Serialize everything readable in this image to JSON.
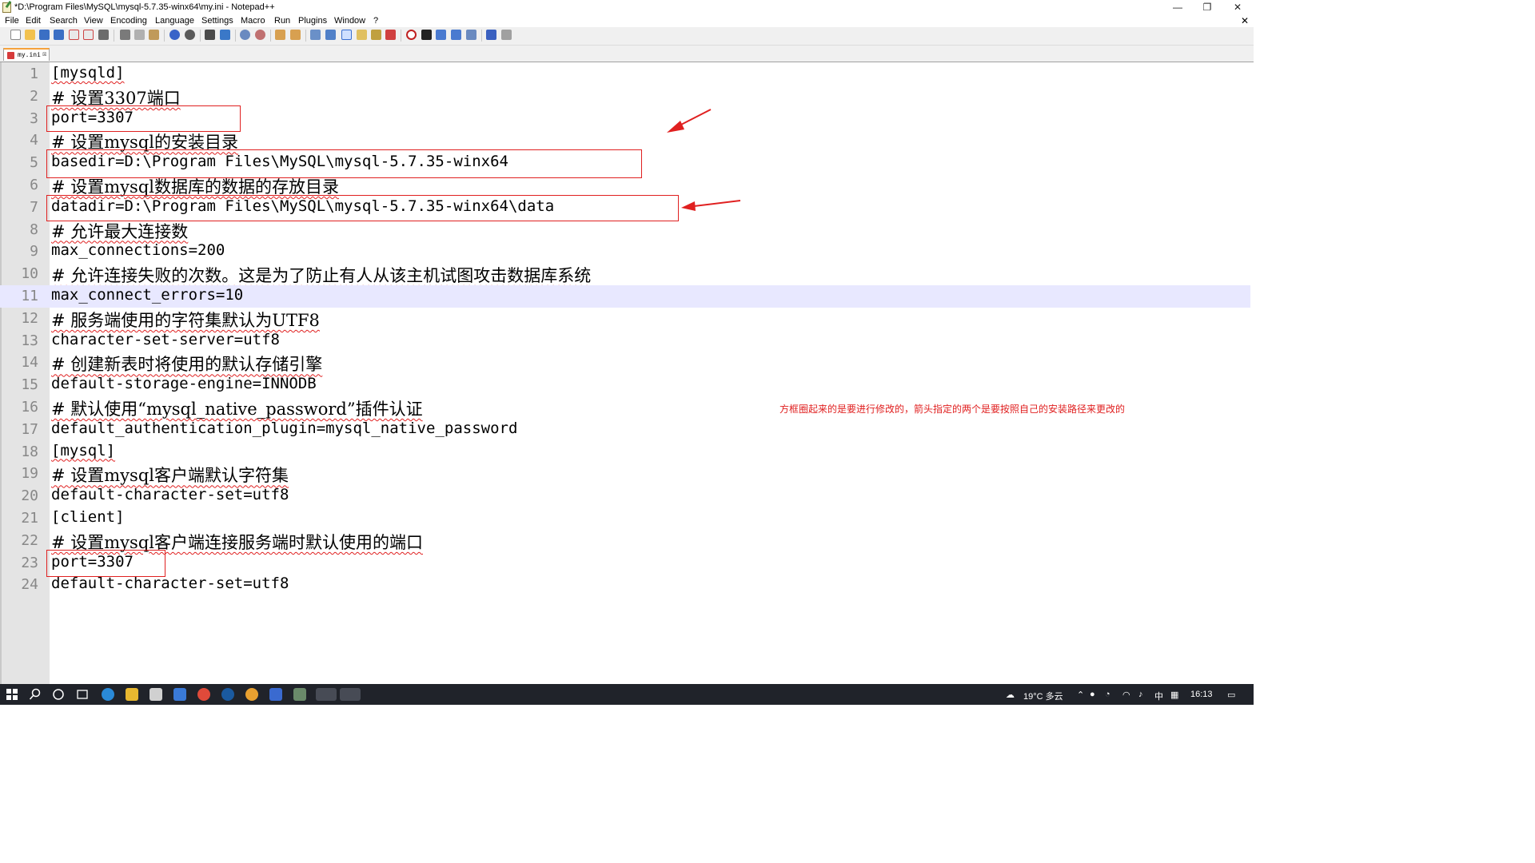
{
  "window": {
    "title": "*D:\\Program Files\\MySQL\\mysql-5.7.35-winx64\\my.ini - Notepad++",
    "minimize": "—",
    "restore": "❐",
    "close": "✕"
  },
  "menu": {
    "items": [
      "File",
      "Edit",
      "Search",
      "View",
      "Encoding",
      "Language",
      "Settings",
      "Macro",
      "Run",
      "Plugins",
      "Window",
      "?"
    ],
    "close": "✕"
  },
  "tab": {
    "label": "my.ini",
    "close": "☒"
  },
  "editor": {
    "current_line": 11,
    "lines": [
      "[mysqld]",
      "# 设置3307端口",
      "port=3307",
      "# 设置mysql的安装目录",
      "basedir=D:\\Program Files\\MySQL\\mysql-5.7.35-winx64",
      "# 设置mysql数据库的数据的存放目录",
      "datadir=D:\\Program Files\\MySQL\\mysql-5.7.35-winx64\\data",
      "# 允许最大连接数",
      "max_connections=200",
      "# 允许连接失败的次数。这是为了防止有人从该主机试图攻击数据库系统",
      "max_connect_errors=10",
      "# 服务端使用的字符集默认为UTF8",
      "character-set-server=utf8",
      "# 创建新表时将使用的默认存储引擎",
      "default-storage-engine=INNODB",
      "# 默认使用“mysql_native_password”插件认证",
      "default_authentication_plugin=mysql_native_password",
      "[mysql]",
      "# 设置mysql客户端默认字符集",
      "default-character-set=utf8",
      "[client]",
      "# 设置mysql客户端连接服务端时默认使用的端口",
      "port=3307",
      "default-character-set=utf8"
    ]
  },
  "annotation": {
    "note": "方框圈起来的是要进行修改的，箭头指定的两个是要按照自己的安装路径来更改的",
    "color": "#e02020"
  },
  "taskbar": {
    "weather": "19°C 多云",
    "ime": "中",
    "time": "16:13"
  }
}
